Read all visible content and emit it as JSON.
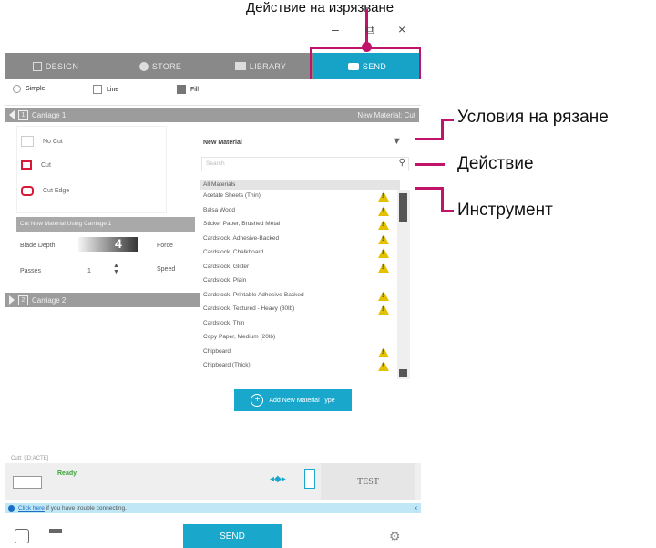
{
  "callouts": {
    "top": "Действие на изрязване",
    "cut_conditions": "Условия на рязане",
    "action": "Действие",
    "tool": "Инструмент"
  },
  "window": {
    "minimize": "–",
    "restore": "⧉",
    "close": "×"
  },
  "nav": {
    "design": "DESIGN",
    "store": "STORE",
    "library": "LIBRARY",
    "send": "SEND"
  },
  "tools": {
    "simple": "Simple",
    "line": "Line",
    "fill": "Fill"
  },
  "carriage1": {
    "num": "1",
    "label": "Carriage 1",
    "right": "New Material: Cut"
  },
  "carriage2": {
    "num": "2",
    "label": "Carriage 2"
  },
  "actions": {
    "no_cut": "No Cut",
    "cut": "Cut",
    "cut_edge": "Cut Edge"
  },
  "cutbar": "Cut New Material Using Carriage 1",
  "settings": {
    "blade_label": "Blade Depth",
    "blade_value": "4",
    "passes_label": "Passes",
    "passes_value": "1",
    "force_label": "Force",
    "speed_label": "Speed"
  },
  "material": {
    "selected": "New Material",
    "search_placeholder": "Search",
    "header": "All Materials",
    "items": [
      "Acetate Sheets (Thin)",
      "Balsa Wood",
      "Sticker Paper, Brushed Metal",
      "Cardstock, Adhesive-Backed",
      "Cardstock, Chalkboard",
      "Cardstock, Glitter",
      "Cardstock, Plain",
      "Cardstock, Printable Adhesive-Backed",
      "Cardstock, Textured - Heavy (80lb)",
      "Cardstock, Thin",
      "Copy Paper, Medium (20lb)",
      "Chipboard",
      "Chipboard (Thick)"
    ],
    "add_label": "Add New Material Type"
  },
  "status": {
    "code": "Cutt: [ID:ACTE]",
    "ready": "Ready",
    "test": "TEST"
  },
  "info": {
    "link": "Click here",
    "text": " if you have trouble connecting.",
    "close": "x"
  },
  "send_button": "SEND"
}
